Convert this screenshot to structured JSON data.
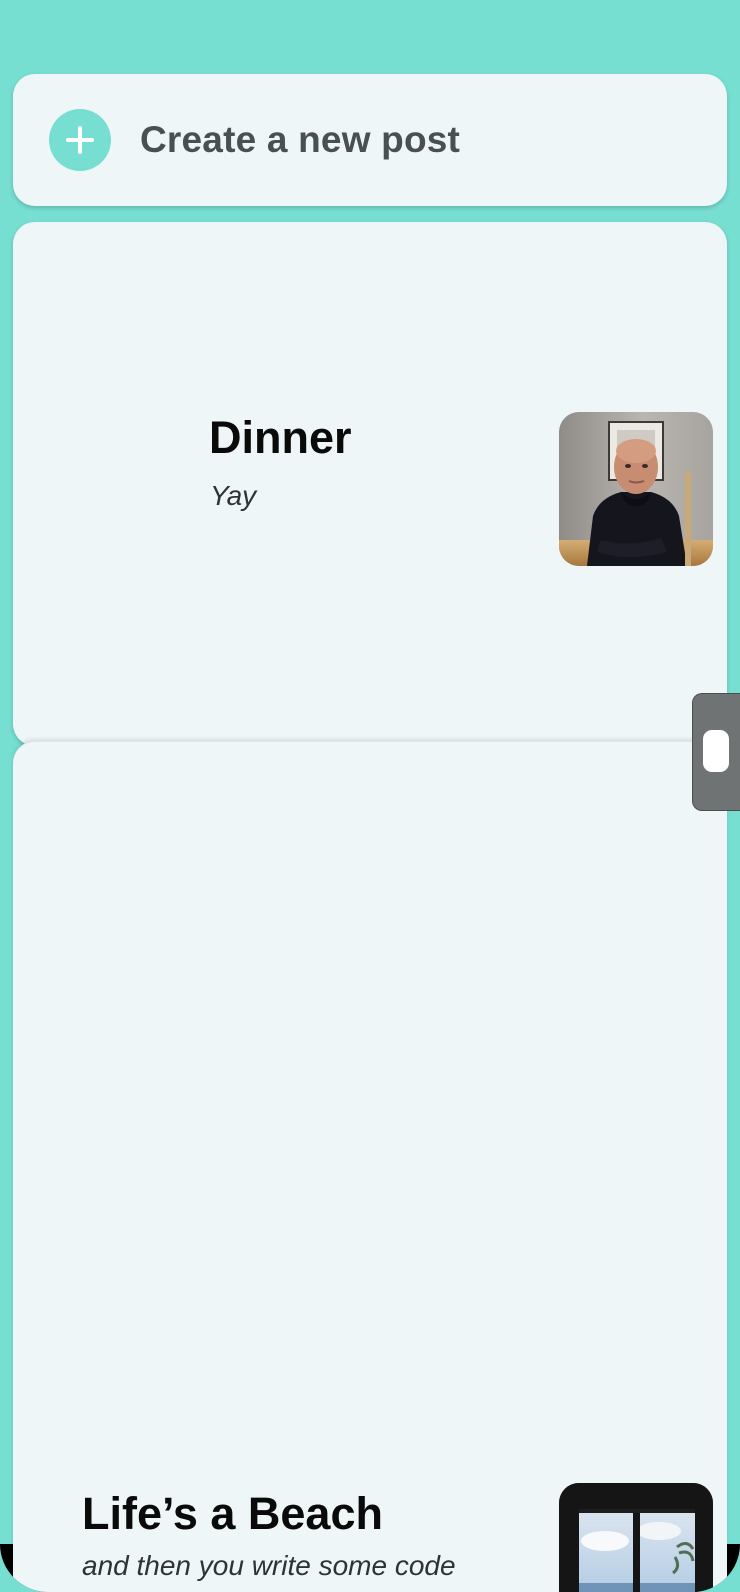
{
  "create_post": {
    "label": "Create a new post",
    "icon": "plus-icon"
  },
  "posts": [
    {
      "title": "Dinner",
      "subtitle": "Yay",
      "thumbnail": "photo of a man seated at a table"
    },
    {
      "title": "Life’s a Beach",
      "subtitle": "and then you write some code",
      "thumbnail": "photo of a window overlooking the sea"
    }
  ],
  "colors": {
    "accent": "#77ded2",
    "card_background": "#eef6f7",
    "title_text": "#0a0a0a",
    "subtitle_text": "#2e3335",
    "create_label_text": "#4a4f52",
    "scroll_tab": "#6f7374"
  }
}
